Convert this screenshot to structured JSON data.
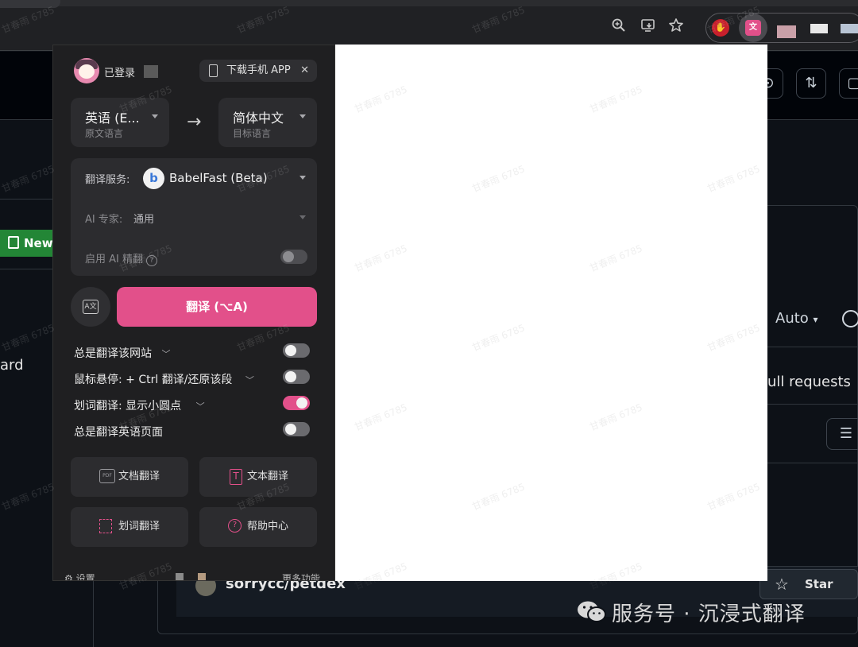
{
  "browser": {
    "zoom_icon": "zoom-in-icon",
    "install_icon": "install-app-icon",
    "bookmark_icon": "star-outline-icon"
  },
  "popup": {
    "user_status": "已登录",
    "download_app": "下载手机 APP",
    "source_lang": {
      "name": "英语 (E...",
      "caption": "原文语言"
    },
    "target_lang": {
      "name": "简体中文",
      "caption": "目标语言"
    },
    "arrow": "→",
    "service_label": "翻译服务:",
    "service_logo": "b",
    "service_name": "BabelFast (Beta)",
    "ai_expert_label": "AI 专家:",
    "ai_expert_value": "通用",
    "ai_refine_label": "启用 AI 精翻",
    "ai_refine_on": false,
    "translate_button": "翻译 (⌥A)",
    "options": [
      {
        "label": "总是翻译该网站",
        "chevron": true,
        "on": false
      },
      {
        "label": "鼠标悬停: + Ctrl 翻译/还原该段",
        "chevron": true,
        "on": false
      },
      {
        "label": "划词翻译: 显示小圆点",
        "chevron": true,
        "on": true
      },
      {
        "label": "总是翻译英语页面",
        "chevron": false,
        "on": false
      }
    ],
    "tools": {
      "doc": "文档翻译",
      "text": "文本翻译",
      "selection": "划词翻译",
      "help": "帮助中心"
    },
    "footer": {
      "settings": "设置",
      "more": "更多功能"
    }
  },
  "github": {
    "new_button": "New",
    "sidebar_fragment": "ard",
    "auto_label": "Auto",
    "pull_requests_fragment": "ull requests",
    "repo_name": "sorrycc/petdex",
    "star_button": "Star"
  },
  "watermark": {
    "text": "服务号 · 沉浸式翻译",
    "user_mark": "甘春雨 6785"
  },
  "colors": {
    "accent": "#e2508a",
    "github_green": "#238636",
    "popup_bg": "#1f1f21",
    "page_bg": "#0d1117"
  }
}
